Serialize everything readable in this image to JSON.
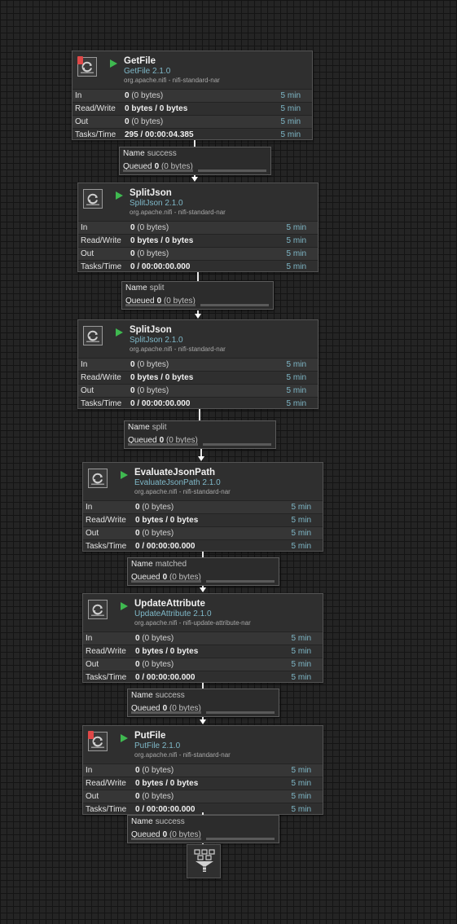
{
  "processors": [
    {
      "id": "getfile",
      "name": "GetFile",
      "type": "GetFile 2.1.0",
      "bundle": "org.apache.nifi - nifi-standard-nar",
      "invalid": true,
      "running": true,
      "stats": {
        "in": {
          "label": "In",
          "count": "0",
          "detail": "(0 bytes)",
          "period": "5 min"
        },
        "read_write": {
          "label": "Read/Write",
          "count": "0 bytes / 0 bytes",
          "detail": "",
          "period": "5 min"
        },
        "out": {
          "label": "Out",
          "count": "0",
          "detail": "(0 bytes)",
          "period": "5 min"
        },
        "tasks_time": {
          "label": "Tasks/Time",
          "count": "295 / 00:00:04.385",
          "detail": "",
          "period": "5 min"
        }
      }
    },
    {
      "id": "splitjson-1",
      "name": "SplitJson",
      "type": "SplitJson 2.1.0",
      "bundle": "org.apache.nifi - nifi-standard-nar",
      "invalid": false,
      "running": true,
      "stats": {
        "in": {
          "label": "In",
          "count": "0",
          "detail": "(0 bytes)",
          "period": "5 min"
        },
        "read_write": {
          "label": "Read/Write",
          "count": "0 bytes / 0 bytes",
          "detail": "",
          "period": "5 min"
        },
        "out": {
          "label": "Out",
          "count": "0",
          "detail": "(0 bytes)",
          "period": "5 min"
        },
        "tasks_time": {
          "label": "Tasks/Time",
          "count": "0 / 00:00:00.000",
          "detail": "",
          "period": "5 min"
        }
      }
    },
    {
      "id": "splitjson-2",
      "name": "SplitJson",
      "type": "SplitJson 2.1.0",
      "bundle": "org.apache.nifi - nifi-standard-nar",
      "invalid": false,
      "running": true,
      "stats": {
        "in": {
          "label": "In",
          "count": "0",
          "detail": "(0 bytes)",
          "period": "5 min"
        },
        "read_write": {
          "label": "Read/Write",
          "count": "0 bytes / 0 bytes",
          "detail": "",
          "period": "5 min"
        },
        "out": {
          "label": "Out",
          "count": "0",
          "detail": "(0 bytes)",
          "period": "5 min"
        },
        "tasks_time": {
          "label": "Tasks/Time",
          "count": "0 / 00:00:00.000",
          "detail": "",
          "period": "5 min"
        }
      }
    },
    {
      "id": "evaluatejsonpath",
      "name": "EvaluateJsonPath",
      "type": "EvaluateJsonPath 2.1.0",
      "bundle": "org.apache.nifi - nifi-standard-nar",
      "invalid": false,
      "running": true,
      "stats": {
        "in": {
          "label": "In",
          "count": "0",
          "detail": "(0 bytes)",
          "period": "5 min"
        },
        "read_write": {
          "label": "Read/Write",
          "count": "0 bytes / 0 bytes",
          "detail": "",
          "period": "5 min"
        },
        "out": {
          "label": "Out",
          "count": "0",
          "detail": "(0 bytes)",
          "period": "5 min"
        },
        "tasks_time": {
          "label": "Tasks/Time",
          "count": "0 / 00:00:00.000",
          "detail": "",
          "period": "5 min"
        }
      }
    },
    {
      "id": "updateattribute",
      "name": "UpdateAttribute",
      "type": "UpdateAttribute 2.1.0",
      "bundle": "org.apache.nifi - nifi-update-attribute-nar",
      "invalid": false,
      "running": true,
      "stats": {
        "in": {
          "label": "In",
          "count": "0",
          "detail": "(0 bytes)",
          "period": "5 min"
        },
        "read_write": {
          "label": "Read/Write",
          "count": "0 bytes / 0 bytes",
          "detail": "",
          "period": "5 min"
        },
        "out": {
          "label": "Out",
          "count": "0",
          "detail": "(0 bytes)",
          "period": "5 min"
        },
        "tasks_time": {
          "label": "Tasks/Time",
          "count": "0 / 00:00:00.000",
          "detail": "",
          "period": "5 min"
        }
      }
    },
    {
      "id": "putfile",
      "name": "PutFile",
      "type": "PutFile 2.1.0",
      "bundle": "org.apache.nifi - nifi-standard-nar",
      "invalid": true,
      "running": true,
      "stats": {
        "in": {
          "label": "In",
          "count": "0",
          "detail": "(0 bytes)",
          "period": "5 min"
        },
        "read_write": {
          "label": "Read/Write",
          "count": "0 bytes / 0 bytes",
          "detail": "",
          "period": "5 min"
        },
        "out": {
          "label": "Out",
          "count": "0",
          "detail": "(0 bytes)",
          "period": "5 min"
        },
        "tasks_time": {
          "label": "Tasks/Time",
          "count": "0 / 00:00:00.000",
          "detail": "",
          "period": "5 min"
        }
      }
    }
  ],
  "connections": [
    {
      "name_label": "Name",
      "name": "success",
      "queued_label": "Queued",
      "queued_count": "0",
      "queued_size": "(0 bytes)"
    },
    {
      "name_label": "Name",
      "name": "split",
      "queued_label": "Queued",
      "queued_count": "0",
      "queued_size": "(0 bytes)"
    },
    {
      "name_label": "Name",
      "name": "split",
      "queued_label": "Queued",
      "queued_count": "0",
      "queued_size": "(0 bytes)"
    },
    {
      "name_label": "Name",
      "name": "matched",
      "queued_label": "Queued",
      "queued_count": "0",
      "queued_size": "(0 bytes)"
    },
    {
      "name_label": "Name",
      "name": "success",
      "queued_label": "Queued",
      "queued_count": "0",
      "queued_size": "(0 bytes)"
    },
    {
      "name_label": "Name",
      "name": "success",
      "queued_label": "Queued",
      "queued_count": "0",
      "queued_size": "(0 bytes)"
    }
  ],
  "funnel": {
    "icon": "funnel-icon"
  },
  "colors": {
    "canvas": "#242424",
    "grid": "#141414",
    "running": "#3fb950",
    "invalid": "#e04848",
    "accent": "#7fb8c8"
  }
}
